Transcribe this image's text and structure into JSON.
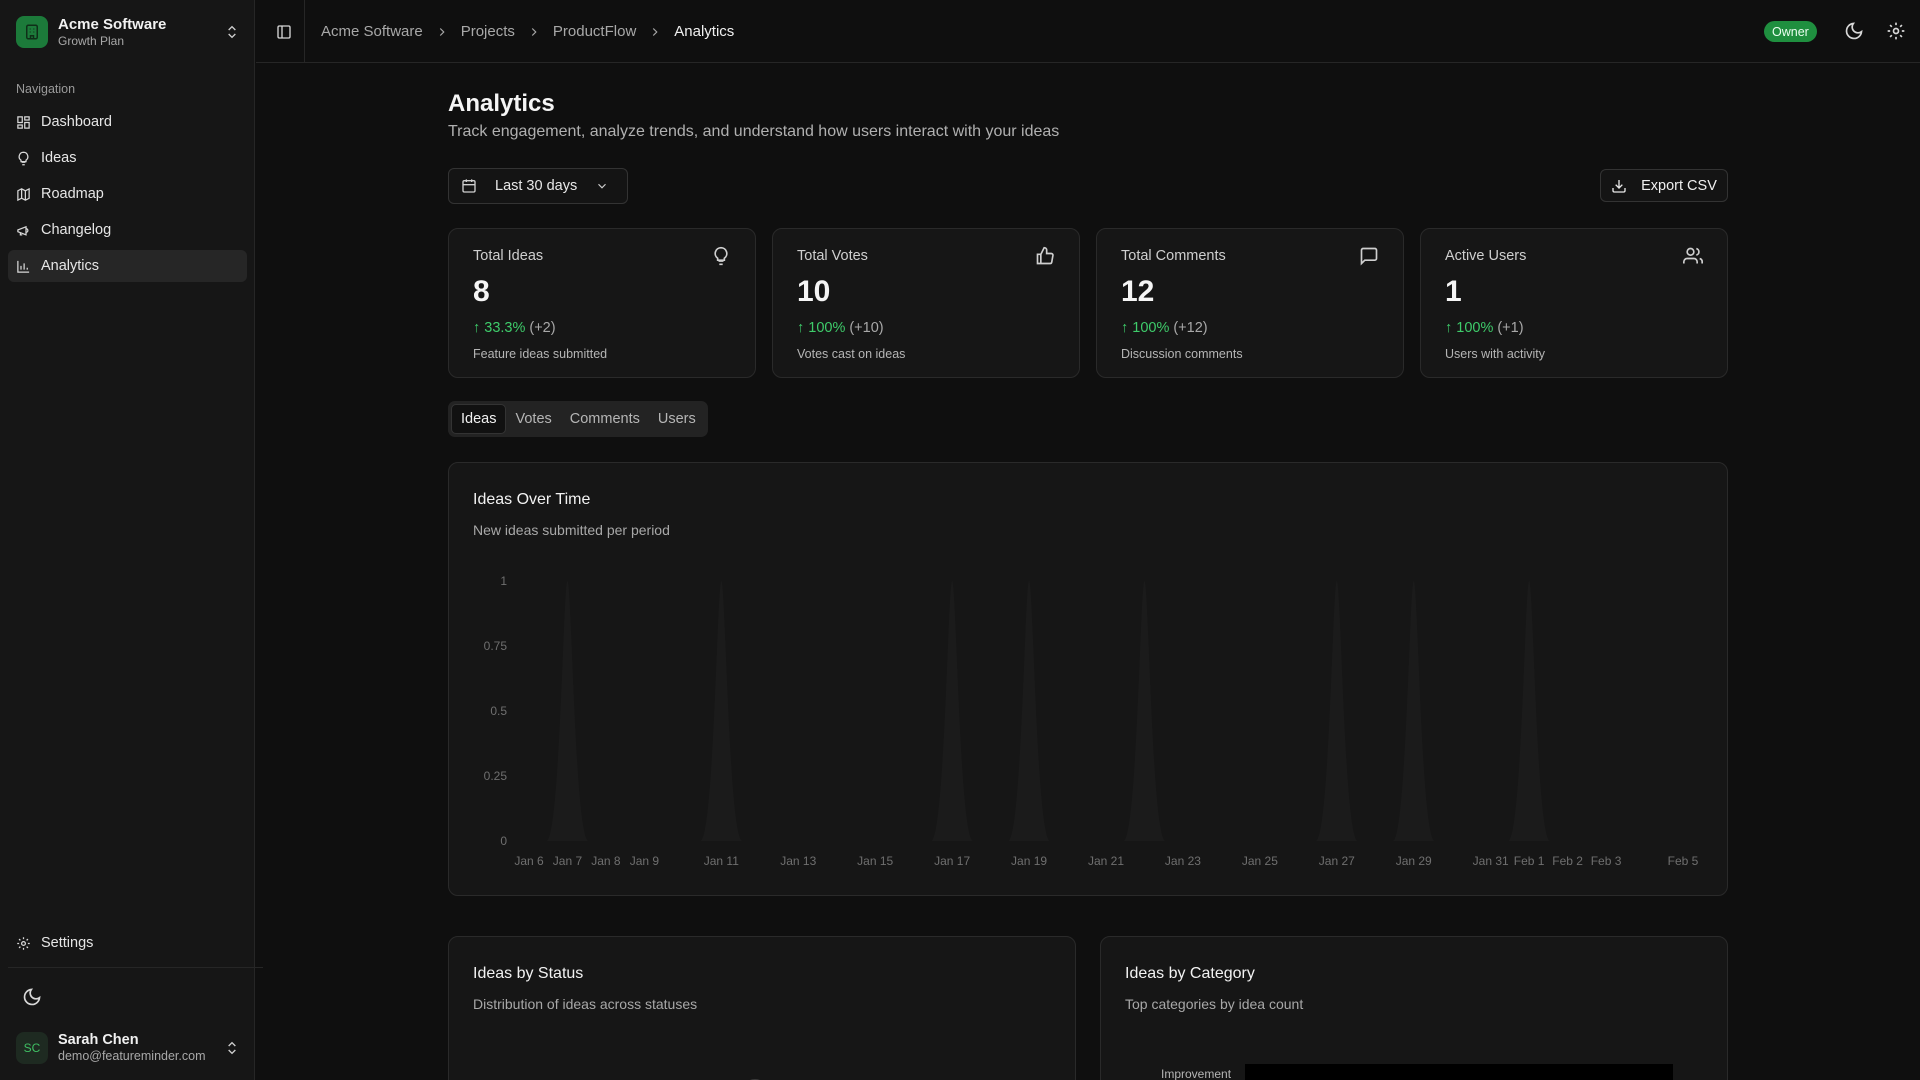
{
  "org": {
    "name": "Acme Software",
    "plan": "Growth Plan"
  },
  "nav": {
    "label": "Navigation",
    "items": [
      {
        "label": "Dashboard",
        "icon": "dashboard-icon"
      },
      {
        "label": "Ideas",
        "icon": "lightbulb-icon"
      },
      {
        "label": "Roadmap",
        "icon": "map-icon"
      },
      {
        "label": "Changelog",
        "icon": "megaphone-icon"
      },
      {
        "label": "Analytics",
        "icon": "bar-chart-icon",
        "active": true
      }
    ],
    "settings": "Settings"
  },
  "user": {
    "initials": "SC",
    "name": "Sarah Chen",
    "email": "demo@featureminder.com"
  },
  "breadcrumb": [
    "Acme Software",
    "Projects",
    "ProductFlow",
    "Analytics"
  ],
  "header": {
    "role_badge": "Owner"
  },
  "page": {
    "title": "Analytics",
    "subtitle": "Track engagement, analyze trends, and understand how users interact with your ideas",
    "date_range": "Last 30 days",
    "export_label": "Export CSV"
  },
  "stats": [
    {
      "label": "Total Ideas",
      "value": "8",
      "change_pct": "33.3%",
      "change_abs": "(+2)",
      "desc": "Feature ideas submitted",
      "icon": "lightbulb-icon"
    },
    {
      "label": "Total Votes",
      "value": "10",
      "change_pct": "100%",
      "change_abs": "(+10)",
      "desc": "Votes cast on ideas",
      "icon": "thumbs-up-icon"
    },
    {
      "label": "Total Comments",
      "value": "12",
      "change_pct": "100%",
      "change_abs": "(+12)",
      "desc": "Discussion comments",
      "icon": "message-square-icon"
    },
    {
      "label": "Active Users",
      "value": "1",
      "change_pct": "100%",
      "change_abs": "(+1)",
      "desc": "Users with activity",
      "icon": "users-icon"
    }
  ],
  "tabs": [
    "Ideas",
    "Votes",
    "Comments",
    "Users"
  ],
  "active_tab": "Ideas",
  "ideas_chart": {
    "title": "Ideas Over Time",
    "subtitle": "New ideas submitted per period"
  },
  "chart_data": {
    "type": "area",
    "x": [
      "Jan 6",
      "Jan 7",
      "Jan 8",
      "Jan 9",
      "Jan 10",
      "Jan 11",
      "Jan 12",
      "Jan 13",
      "Jan 14",
      "Jan 15",
      "Jan 16",
      "Jan 17",
      "Jan 18",
      "Jan 19",
      "Jan 20",
      "Jan 21",
      "Jan 22",
      "Jan 23",
      "Jan 24",
      "Jan 25",
      "Jan 26",
      "Jan 27",
      "Jan 28",
      "Jan 29",
      "Jan 30",
      "Jan 31",
      "Feb 1",
      "Feb 2",
      "Feb 3",
      "Feb 4",
      "Feb 5"
    ],
    "x_tick_labels": [
      "Jan 6",
      "Jan 7",
      "Jan 8",
      "Jan 9",
      "Jan 11",
      "Jan 13",
      "Jan 15",
      "Jan 17",
      "Jan 19",
      "Jan 21",
      "Jan 23",
      "Jan 25",
      "Jan 27",
      "Jan 29",
      "Jan 31",
      "Feb 1",
      "Feb 2",
      "Feb 3",
      "Feb 5"
    ],
    "series": [
      {
        "values": [
          0,
          1,
          0,
          0,
          0,
          1,
          0,
          0,
          0,
          0,
          0,
          1,
          0,
          1,
          0,
          0,
          1,
          0,
          0,
          0,
          0,
          1,
          0,
          1,
          0,
          0,
          1,
          0,
          0,
          0,
          0
        ]
      }
    ],
    "y_ticks": [
      "0",
      "0.25",
      "0.5",
      "0.75",
      "1"
    ],
    "ylim": [
      0,
      1
    ],
    "grid": false,
    "colors": {
      "fill": "#1b1b1b"
    }
  },
  "status_card": {
    "title": "Ideas by Status",
    "subtitle": "Distribution of ideas across statuses"
  },
  "category_card": {
    "title": "Ideas by Category",
    "subtitle": "Top categories by idea count",
    "first_category": "Improvement"
  },
  "colors": {
    "accent": "#1f8f3f",
    "positive": "#3ecb6a"
  }
}
